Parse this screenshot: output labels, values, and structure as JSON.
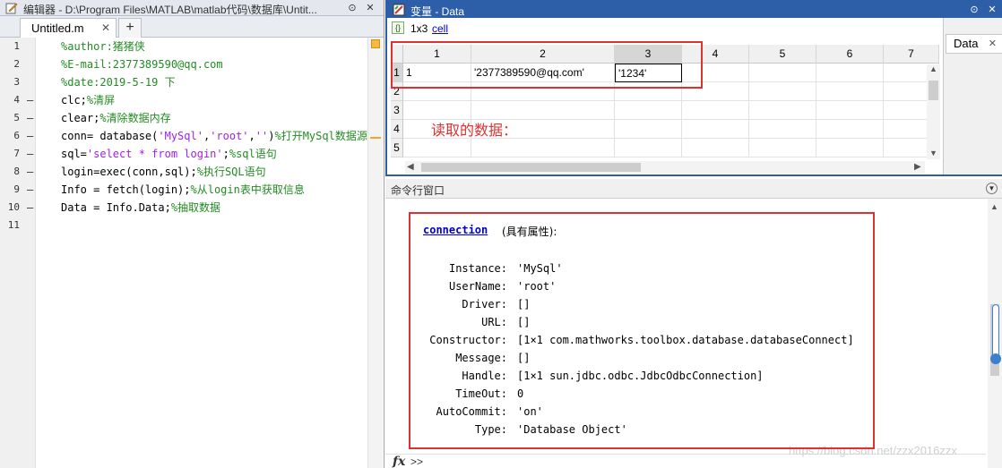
{
  "editor": {
    "title": "编辑器 - D:\\Program Files\\MATLAB\\matlab代码\\数据库\\Untit...",
    "tab_label": "Untitled.m",
    "close_glyph": "✕",
    "add_glyph": "+",
    "lines": [
      {
        "n": "1",
        "dash": "",
        "code": [
          {
            "t": "%author:猪猪侠",
            "c": "c"
          }
        ]
      },
      {
        "n": "2",
        "dash": "",
        "code": [
          {
            "t": "%E-mail:2377389590@qq.com",
            "c": "c"
          }
        ]
      },
      {
        "n": "3",
        "dash": "",
        "code": [
          {
            "t": "%date:2019-5-19 下",
            "c": "c"
          }
        ]
      },
      {
        "n": "4",
        "dash": "—",
        "code": [
          {
            "t": "clc;",
            "c": ""
          },
          {
            "t": "%清屏",
            "c": "c"
          }
        ]
      },
      {
        "n": "5",
        "dash": "—",
        "code": [
          {
            "t": "clear;",
            "c": ""
          },
          {
            "t": "%清除数据内存",
            "c": "c"
          }
        ]
      },
      {
        "n": "6",
        "dash": "—",
        "code": [
          {
            "t": "conn= database(",
            "c": ""
          },
          {
            "t": "'MySql'",
            "c": "s"
          },
          {
            "t": ",",
            "c": ""
          },
          {
            "t": "'root'",
            "c": "s"
          },
          {
            "t": ",",
            "c": ""
          },
          {
            "t": "''",
            "c": "s"
          },
          {
            "t": ")",
            "c": ""
          },
          {
            "t": "%打开MySql数据源(",
            "c": "c"
          }
        ]
      },
      {
        "n": "7",
        "dash": "—",
        "code": [
          {
            "t": "sql=",
            "c": ""
          },
          {
            "t": "'select * from login'",
            "c": "s"
          },
          {
            "t": ";",
            "c": ""
          },
          {
            "t": "%sql语句",
            "c": "c"
          }
        ]
      },
      {
        "n": "8",
        "dash": "—",
        "code": [
          {
            "t": "login=exec(conn,sql);",
            "c": ""
          },
          {
            "t": "%执行SQL语句",
            "c": "c"
          }
        ]
      },
      {
        "n": "9",
        "dash": "—",
        "code": [
          {
            "t": "Info = fetch(login);",
            "c": ""
          },
          {
            "t": "%从login表中获取信息",
            "c": "c"
          }
        ]
      },
      {
        "n": "10",
        "dash": "—",
        "code": [
          {
            "t": "Data = Info.Data;",
            "c": ""
          },
          {
            "t": "%抽取数据",
            "c": "c"
          }
        ]
      },
      {
        "n": "11",
        "dash": "",
        "code": []
      }
    ]
  },
  "variables": {
    "title": "变量 - Data",
    "size": "1x3",
    "class_link": "cell",
    "side_tab": "Data",
    "col_headers": [
      "1",
      "2",
      "3",
      "4",
      "5",
      "6",
      "7"
    ],
    "row_headers": [
      "1",
      "2",
      "3",
      "4",
      "5"
    ],
    "row1": [
      "1",
      "'2377389590@qq.com'",
      "'1234'"
    ],
    "note": "读取的数据："
  },
  "command_window": {
    "title": "命令行窗口",
    "object_link": "connection",
    "object_suffix": "(具有属性):",
    "properties": [
      {
        "name": "Instance:",
        "value": "'MySql'"
      },
      {
        "name": "UserName:",
        "value": "'root'"
      },
      {
        "name": "Driver:",
        "value": "[]"
      },
      {
        "name": "URL:",
        "value": "[]"
      },
      {
        "name": "Constructor:",
        "value": "[1×1 com.mathworks.toolbox.database.databaseConnect]"
      },
      {
        "name": "Message:",
        "value": "[]"
      },
      {
        "name": "Handle:",
        "value": "[1×1 sun.jdbc.odbc.JdbcOdbcConnection]"
      },
      {
        "name": "TimeOut:",
        "value": "0"
      },
      {
        "name": "AutoCommit:",
        "value": "'on'"
      },
      {
        "name": "Type:",
        "value": "'Database Object'"
      }
    ],
    "prompt_fx": "fx",
    "prompt": ">>",
    "watermark": "https://blog.csdn.net/zzx2016zzx"
  },
  "colors": {
    "accent": "#2d5fa8",
    "annotation_red": "#e03131",
    "comment": "#228b22",
    "string": "#a020f0"
  }
}
